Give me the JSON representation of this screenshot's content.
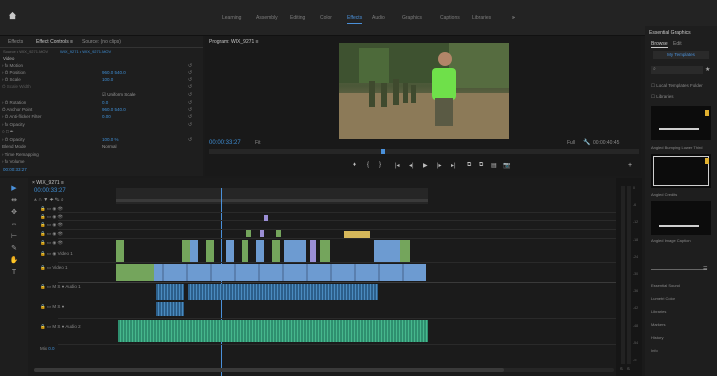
{
  "workspaces": [
    "Learning",
    "Assembly",
    "Editing",
    "Color",
    "Effects",
    "Audio",
    "Graphics",
    "Captions",
    "Libraries"
  ],
  "active_workspace": "Effects",
  "more_icon": "»",
  "left_panel": {
    "tabs": [
      "Effects",
      "Effect Controls ≡",
      "Source: (no clips)"
    ],
    "source_path": "Source • WIX_9271.MOV",
    "clip_path": "WIX_9271 • WIX_9271.MOV",
    "section_video": "Video",
    "rows": [
      {
        "label": "› fx Motion",
        "value": ""
      },
      {
        "label": "› Ö Position",
        "value": "960.0   540.0"
      },
      {
        "label": "› Ö Scale",
        "value": "100.0"
      },
      {
        "label": "   Ö Scale Width",
        "value": ""
      },
      {
        "label": "",
        "value": "☑ Uniform Scale"
      },
      {
        "label": "› Ö Rotation",
        "value": "0.0"
      },
      {
        "label": "   Ö Anchor Point",
        "value": "960.0   540.0"
      },
      {
        "label": "› Ö Anti-flicker Filter",
        "value": "0.00"
      },
      {
        "label": "› fx Opacity",
        "value": ""
      },
      {
        "label": "   ○ □ ✒",
        "value": ""
      },
      {
        "label": "› Ö Opacity",
        "value": "100.0 %"
      },
      {
        "label": "   Blend Mode",
        "value": "Normal"
      },
      {
        "label": "› Time Remapping",
        "value": ""
      },
      {
        "label": "› fx Volume",
        "value": ""
      }
    ],
    "timecode": "00:00:33:27"
  },
  "program": {
    "title": "Program: WIX_9271 ≡",
    "timecode": "00:00:33:27",
    "fit": "Fit",
    "full": "Full",
    "duration": "00:00:40:45",
    "controls": [
      "♦",
      "{",
      "}",
      "|◂",
      "◂|",
      "▶",
      "|▸",
      "▸|",
      "⧉",
      "⧉",
      "▤",
      "📷"
    ],
    "playhead_fraction": 0.4
  },
  "timeline": {
    "title": "× WIX_9271 ≡",
    "timecode": "00:00:33:27",
    "tools": [
      "▶",
      "⇹",
      "✥",
      "⇔",
      "⊢",
      "✎",
      "✋",
      "T"
    ],
    "tracks": [
      {
        "name": "V4",
        "label": ""
      },
      {
        "name": "V3",
        "label": ""
      },
      {
        "name": "V2",
        "label": ""
      },
      {
        "name": "V1",
        "label": "Video 1"
      },
      {
        "name": "A1",
        "label": "Audio 1"
      },
      {
        "name": "A2",
        "label": "Audio 2"
      },
      {
        "name": "A3",
        "label": "Audio 3"
      },
      {
        "name": "Mix",
        "label": "Mix"
      }
    ],
    "mix_value": "0.0",
    "meter_ticks": [
      "0",
      "-6",
      "-12",
      "-18",
      "-24",
      "-30",
      "-36",
      "-42",
      "-48",
      "-54",
      "-∞"
    ],
    "meter_labels": [
      "S",
      "S"
    ]
  },
  "essential": {
    "title": "Essential Graphics",
    "tabs": [
      "Browse",
      "Edit"
    ],
    "search_placeholder": "My Templates",
    "checkboxes": [
      "Local Templates Folder",
      "Libraries"
    ],
    "templates": [
      "Angled Bumping Lower Third",
      "Angled Credits",
      "Angled Image Caption"
    ],
    "sections": [
      "Essential Sound",
      "Lumetri Color",
      "Libraries",
      "Markers",
      "History",
      "Info"
    ]
  },
  "colors": {
    "accent": "#4a90d9",
    "video_clip": "#6d9bd1",
    "graphic_clip": "#74a55c",
    "audio_clip": "#2d5f8a",
    "music_clip": "#2f8f6f"
  }
}
